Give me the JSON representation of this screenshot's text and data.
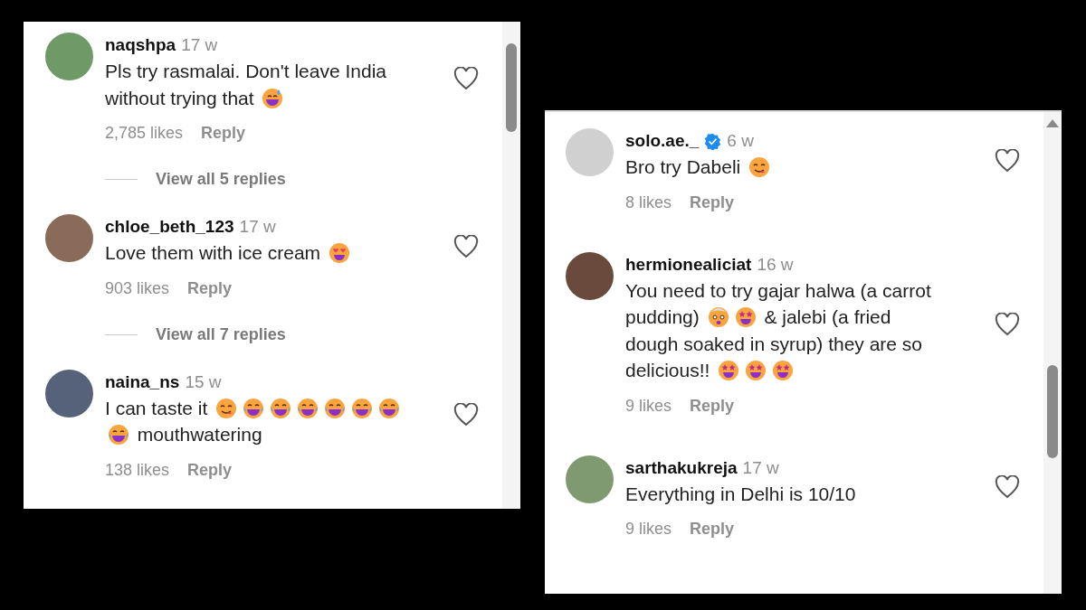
{
  "panels": [
    {
      "comments": [
        {
          "user": "naqshpa",
          "verified": false,
          "time": "17 w",
          "body": [
            {
              "kind": "text",
              "text": "Pls try rasmalai. Don't leave India without trying that "
            },
            {
              "kind": "grin-sweat"
            }
          ],
          "likes": "2,785 likes",
          "reply": "Reply",
          "replies_link": "View all 5 replies"
        },
        {
          "user": "chloe_beth_123",
          "verified": false,
          "time": "17 w",
          "body": [
            {
              "kind": "text",
              "text": "Love them with ice cream "
            },
            {
              "kind": "heart-eyes"
            }
          ],
          "likes": "903 likes",
          "reply": "Reply",
          "replies_link": "View all 7 replies"
        },
        {
          "user": "naina_ns",
          "verified": false,
          "time": "15 w",
          "body": [
            {
              "kind": "text",
              "text": "I can taste it "
            },
            {
              "kind": "yum"
            },
            {
              "kind": "tears-of-joy"
            },
            {
              "kind": "tears-of-joy"
            },
            {
              "kind": "tears-of-joy"
            },
            {
              "kind": "tears-of-joy"
            },
            {
              "kind": "tears-of-joy"
            },
            {
              "kind": "tears-of-joy"
            },
            {
              "kind": "tears-of-joy"
            },
            {
              "kind": "text",
              "text": " mouthwatering"
            }
          ],
          "likes": "138 likes",
          "reply": "Reply"
        }
      ]
    },
    {
      "comments": [
        {
          "user": "solo.ae._",
          "verified": true,
          "time": "6 w",
          "body": [
            {
              "kind": "text",
              "text": "Bro try Dabeli "
            },
            {
              "kind": "yum"
            }
          ],
          "likes": "8 likes",
          "reply": "Reply"
        },
        {
          "user": "hermionealiciat",
          "verified": false,
          "time": "16 w",
          "body": [
            {
              "kind": "text",
              "text": "You need to try gajar halwa (a carrot pudding) "
            },
            {
              "kind": "mind-blown"
            },
            {
              "kind": "star-struck"
            },
            {
              "kind": "text",
              "text": " & jalebi (a fried dough soaked in syrup) they are so delicious!! "
            },
            {
              "kind": "star-struck"
            },
            {
              "kind": "star-struck"
            },
            {
              "kind": "star-struck"
            }
          ],
          "likes": "9 likes",
          "reply": "Reply"
        },
        {
          "user": "sarthakukreja",
          "verified": false,
          "time": "17 w",
          "body": [
            {
              "kind": "text",
              "text": "Everything in Delhi is 10/10"
            }
          ],
          "likes": "9 likes",
          "reply": "Reply"
        }
      ]
    }
  ]
}
